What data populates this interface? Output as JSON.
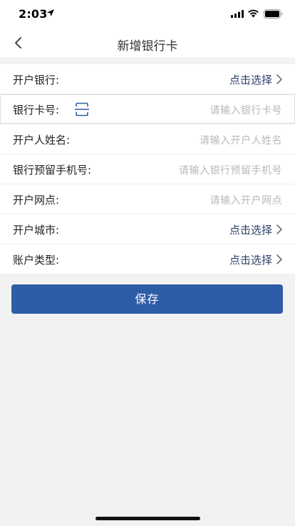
{
  "status": {
    "time": "2:03"
  },
  "nav": {
    "title": "新增银行卡"
  },
  "form": {
    "bank": {
      "label": "开户银行:",
      "value": "点击选择"
    },
    "card_number": {
      "label": "银行卡号:",
      "placeholder": "请输入银行卡号"
    },
    "account_name": {
      "label": "开户人姓名:",
      "placeholder": "请输入开户人姓名"
    },
    "phone": {
      "label": "银行预留手机号:",
      "placeholder": "请输入银行预留手机号"
    },
    "branch": {
      "label": "开户网点:",
      "placeholder": "请输入开户网点"
    },
    "city": {
      "label": "开户城市:",
      "value": "点击选择"
    },
    "account_type": {
      "label": "账户类型:",
      "value": "点击选择"
    }
  },
  "actions": {
    "save_label": "保存"
  },
  "colors": {
    "primary": "#2e5da8",
    "value_text": "#2c3e66",
    "placeholder": "#b8b8b8",
    "background": "#f2f2f2"
  },
  "icons": {
    "back": "chevron-left-icon",
    "chevron": "chevron-right-icon",
    "scan": "scan-icon"
  }
}
